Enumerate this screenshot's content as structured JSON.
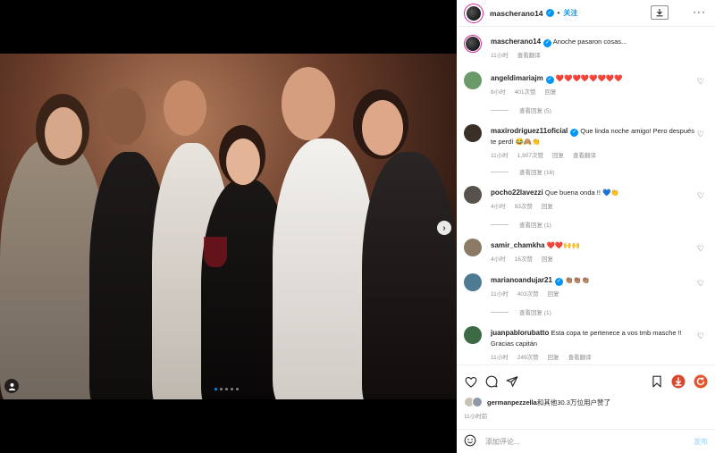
{
  "post": {
    "username": "mascherano14",
    "follow_label": "关注",
    "dot": "•"
  },
  "caption": {
    "username": "mascherano14",
    "text": "Anoche pasaron cosas...",
    "time": "11小时",
    "translate": "查看翻译"
  },
  "comments": [
    {
      "username": "angeldimariajm",
      "verified": true,
      "text": "❤️❤️❤️❤️❤️❤️❤️❤️",
      "time": "8小时",
      "likes": "401次赞",
      "reply": "回复",
      "view_replies": "查看回复 (5)"
    },
    {
      "username": "maxirodriguez11oficial",
      "verified": true,
      "text": "Que linda noche amigo! Pero después te perdí 😂🙈👏",
      "time": "11小时",
      "likes": "1,907次赞",
      "reply": "回复",
      "translate": "查看翻译",
      "view_replies": "查看回复 (16)"
    },
    {
      "username": "pocho22lavezzi",
      "verified": false,
      "text": "Que buena onda !! 💙👏",
      "time": "4小时",
      "likes": "93次赞",
      "reply": "回复",
      "view_replies": "查看回复 (1)"
    },
    {
      "username": "samir_chamkha",
      "verified": false,
      "text": "❤️❤️🙌🙌",
      "time": "4小时",
      "likes": "16次赞",
      "reply": "回复",
      "view_replies": ""
    },
    {
      "username": "marianoandujar21",
      "verified": true,
      "text": "👏🏽👏🏽👏🏽",
      "time": "11小时",
      "likes": "403次赞",
      "reply": "回复",
      "view_replies": "查看回复 (1)"
    },
    {
      "username": "juanpablorubatto",
      "verified": false,
      "text": "Esta copa te pertenece a vos tmb masche !! Gracias capitán",
      "time": "11小时",
      "likes": "249次赞",
      "reply": "回复",
      "translate": "查看翻译",
      "view_replies": ""
    }
  ],
  "likes_summary": {
    "text_user": "germanpezzella",
    "text_rest": "和其他30.3万位用户赞了"
  },
  "post_time": "11小时前",
  "comment_input": {
    "placeholder": "添加评论..."
  },
  "post_button": "发布",
  "colors": {
    "accent": "#0095f6",
    "heart": "#ed4956"
  },
  "icons": [
    "heart-icon",
    "comment-icon",
    "share-icon",
    "bookmark-icon",
    "download-icon",
    "more-icon",
    "emoji-icon",
    "user-tag-icon",
    "next-arrow-icon"
  ]
}
